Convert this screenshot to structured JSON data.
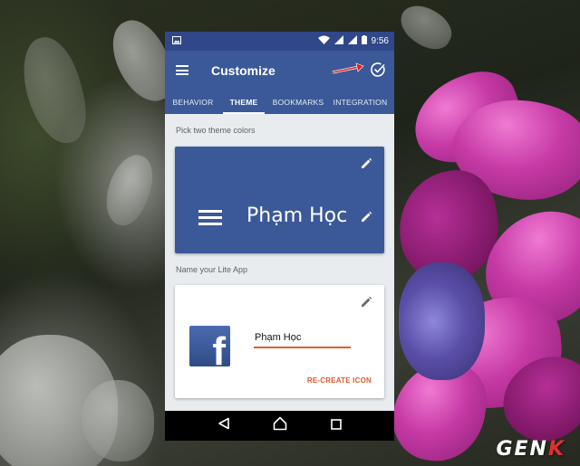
{
  "status_bar": {
    "time": "9:56"
  },
  "app_bar": {
    "title": "Customize"
  },
  "tabs": [
    {
      "label": "BEHAVIOR",
      "active": false
    },
    {
      "label": "THEME",
      "active": true
    },
    {
      "label": "BOOKMARKS",
      "active": false
    },
    {
      "label": "INTEGRATION",
      "active": false
    }
  ],
  "theme_section": {
    "label": "Pick two theme colors",
    "app_name": "Phạm Học"
  },
  "name_section": {
    "label": "Name your Lite App",
    "name_value": "Phạm Học",
    "recreate_label": "RE-CREATE ICON"
  },
  "colors": {
    "status_bar": "#30478a",
    "primary": "#3b5998",
    "background": "#e9ecef",
    "accent": "#e0592a",
    "annotation_arrow": "#e02020"
  },
  "icons": {
    "menu": "menu-icon",
    "confirm": "check-circle-icon",
    "edit": "pencil-icon",
    "nav_back": "triangle-back-icon",
    "nav_home": "circle-home-icon",
    "nav_recents": "square-recents-icon"
  },
  "watermark": {
    "prefix": "GEN",
    "suffix": "K"
  }
}
